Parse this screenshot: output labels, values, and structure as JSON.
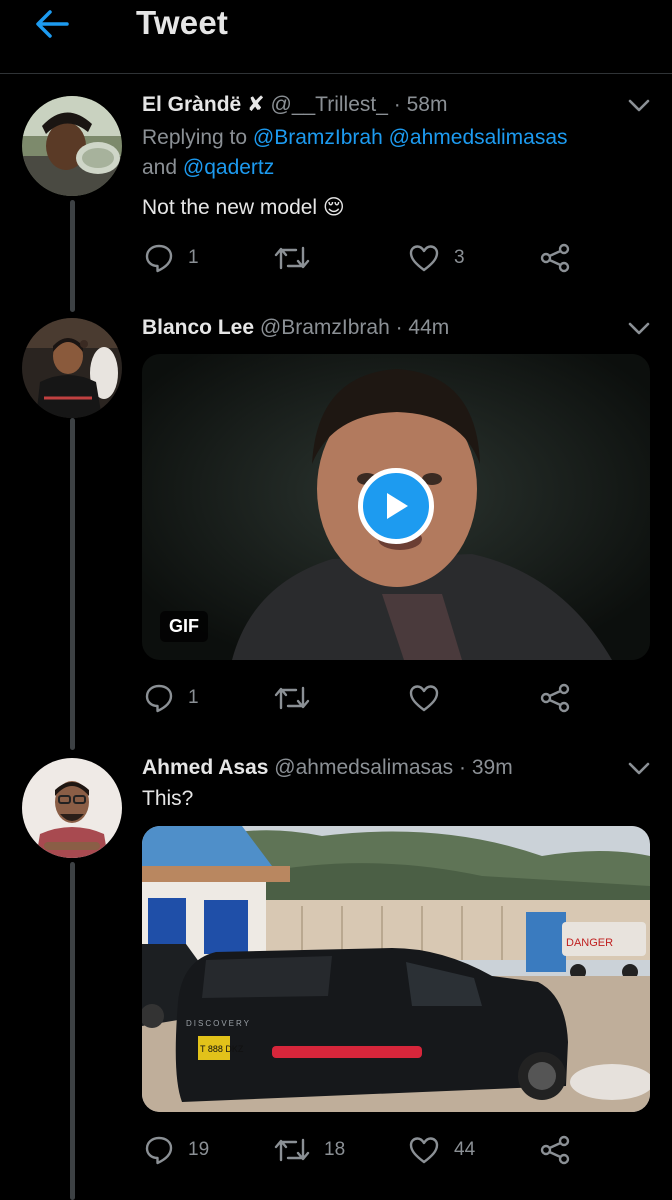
{
  "header": {
    "title": "Tweet"
  },
  "tweets": [
    {
      "name": "El Gràndë",
      "badge": "✘",
      "handle": "@__Trillest_",
      "time": "· 58m",
      "replying_prefix": "Replying to",
      "mentions": [
        "@BramzIbrah",
        "@ahmedsalimasas"
      ],
      "and_word": "and",
      "mention_last": "@qadertz",
      "text": "Not the new model 😌",
      "reply_count": "1",
      "retweet_count": "",
      "like_count": "3"
    },
    {
      "name": "Blanco Lee",
      "handle": "@BramzIbrah",
      "time": "· 44m",
      "media_badge": "GIF",
      "reply_count": "1",
      "retweet_count": "",
      "like_count": ""
    },
    {
      "name": "Ahmed Asas",
      "handle": "@ahmedsalimasas",
      "time": "· 39m",
      "text": "This?",
      "car_brand": "DISCOVERY",
      "plate": "T 888 DKZ",
      "truck_sign": "DANGER",
      "reply_count": "19",
      "retweet_count": "18",
      "like_count": "44"
    }
  ],
  "icons": {
    "back": "arrow-left-icon",
    "reply": "speech-bubble-icon",
    "retweet": "retweet-icon",
    "like": "heart-icon",
    "share": "share-icon",
    "caret": "chevron-down-icon",
    "play": "play-icon"
  },
  "colors": {
    "accent": "#1d9bf0",
    "background": "#000000",
    "muted": "#8b9095"
  }
}
